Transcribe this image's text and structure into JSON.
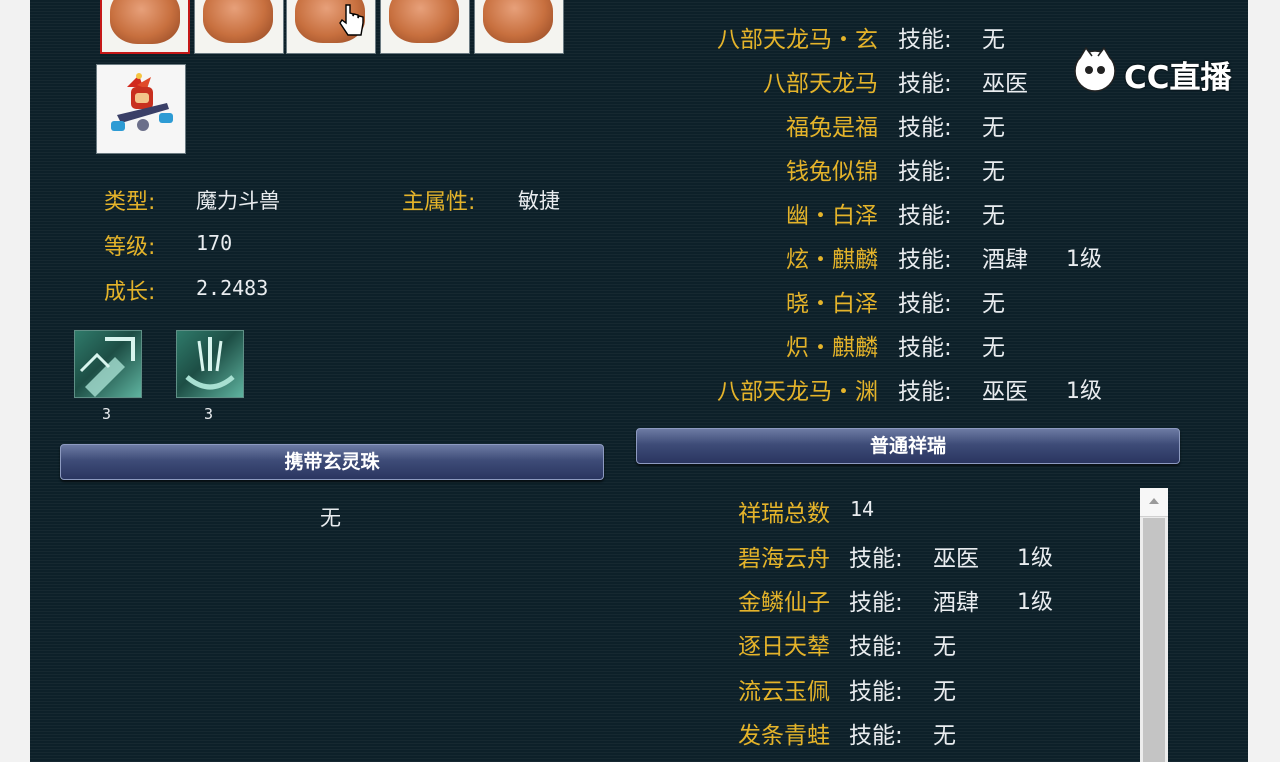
{
  "pet": {
    "type_label": "类型:",
    "type_value": "魔力斗兽",
    "main_attr_label": "主属性:",
    "main_attr_value": "敏捷",
    "level_label": "等级:",
    "level_value": "170",
    "growth_label": "成长:",
    "growth_value": "2.2483"
  },
  "skills": [
    {
      "icon": "shield-skill-icon",
      "level": "3"
    },
    {
      "icon": "claw-skill-icon",
      "level": "3"
    }
  ],
  "carry_orb": {
    "title": "携带玄灵珠",
    "value": "无"
  },
  "mounts": [
    {
      "name": "八部天龙马・玄",
      "key": "技能:",
      "skill": "无",
      "level": ""
    },
    {
      "name": "八部天龙马",
      "key": "技能:",
      "skill": "巫医",
      "level": ""
    },
    {
      "name": "福兔是福",
      "key": "技能:",
      "skill": "无",
      "level": ""
    },
    {
      "name": "钱兔似锦",
      "key": "技能:",
      "skill": "无",
      "level": ""
    },
    {
      "name": "幽・白泽",
      "key": "技能:",
      "skill": "无",
      "level": ""
    },
    {
      "name": "炫・麒麟",
      "key": "技能:",
      "skill": "酒肆",
      "level": "1级"
    },
    {
      "name": "晓・白泽",
      "key": "技能:",
      "skill": "无",
      "level": ""
    },
    {
      "name": "炽・麒麟",
      "key": "技能:",
      "skill": "无",
      "level": ""
    },
    {
      "name": "八部天龙马・渊",
      "key": "技能:",
      "skill": "巫医",
      "level": "1级"
    }
  ],
  "xiangrui": {
    "title": "普通祥瑞",
    "total_label": "祥瑞总数",
    "total_value": "14",
    "items": [
      {
        "name": "碧海云舟",
        "key": "技能:",
        "skill": "巫医",
        "level": "1级"
      },
      {
        "name": "金鳞仙子",
        "key": "技能:",
        "skill": "酒肆",
        "level": "1级"
      },
      {
        "name": "逐日天辇",
        "key": "技能:",
        "skill": "无",
        "level": ""
      },
      {
        "name": "流云玉佩",
        "key": "技能:",
        "skill": "无",
        "level": ""
      },
      {
        "name": "发条青蛙",
        "key": "技能:",
        "skill": "无",
        "level": ""
      }
    ]
  },
  "watermark": {
    "text": "CC直播"
  },
  "colors": {
    "label_gold": "#e4b32a",
    "panel_bg": "#0d2029",
    "section_bar": "#3e4c78"
  }
}
